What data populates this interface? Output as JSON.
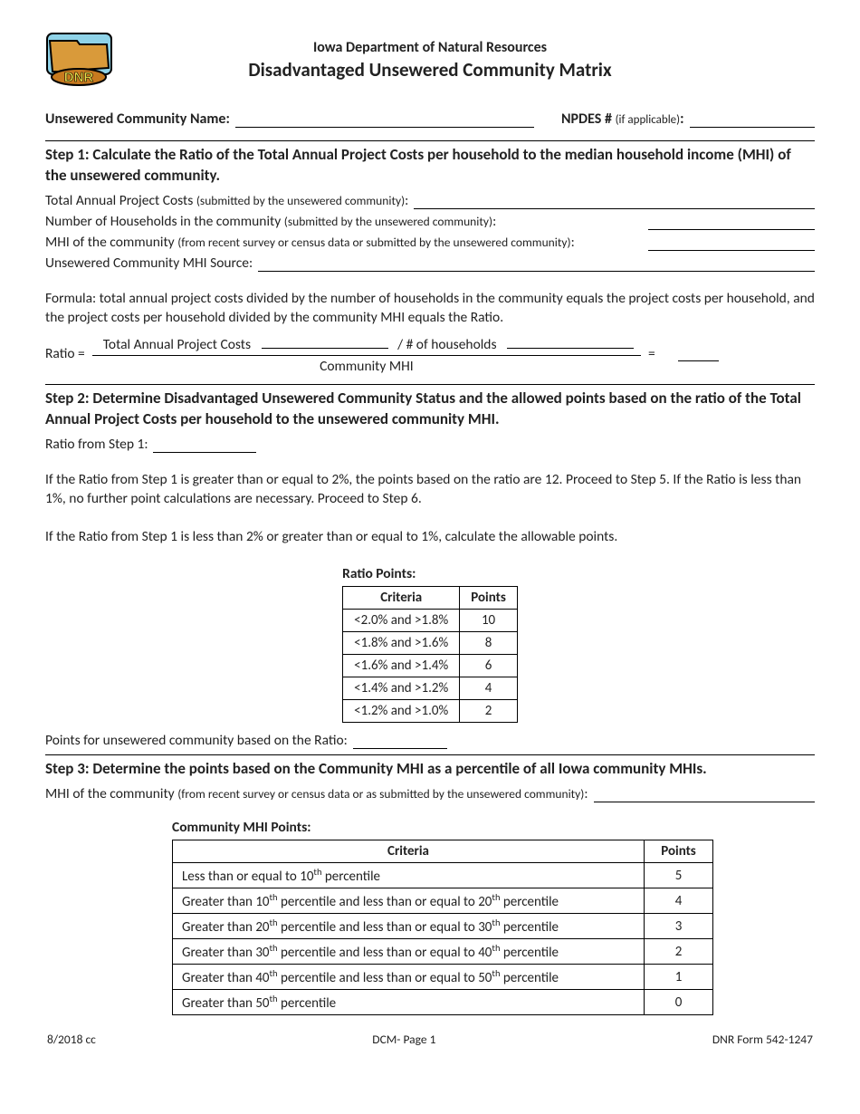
{
  "header": {
    "department": "Iowa Department of Natural Resources",
    "title": "Disadvantaged Unsewered Community Matrix"
  },
  "top": {
    "community_label": "Unsewered Community Name:",
    "npdes_label": "NPDES #",
    "npdes_paren": "(if applicable)",
    "community_value": "",
    "npdes_value": ""
  },
  "step1": {
    "heading": "Step 1: Calculate the Ratio of the Total Annual Project Costs per household to the median household income (MHI) of the unsewered community.",
    "tapc_label": "Total Annual Project Costs",
    "tapc_paren": "(submitted by the unsewered community)",
    "hh_label": "Number of Households in the community",
    "hh_paren": "(submitted by the unsewered community)",
    "mhi_label": "MHI of the community",
    "mhi_paren": "(from recent survey or census data or submitted by the unsewered community)",
    "mhisrc_label": "Unsewered Community MHI Source:",
    "formula_text": "Formula: total annual project costs divided by the number of households in the community equals the project costs per household, and the project costs per household divided by the community MHI equals the Ratio.",
    "ratio_label": "Ratio =",
    "frac_num_left": "Total Annual Project Costs",
    "frac_num_right": "/ # of households",
    "frac_den": "Community MHI",
    "equals": "=",
    "tapc_value": "",
    "hh_value": "",
    "mhi_value": "",
    "mhisrc_value": "",
    "ratio_hh_value": "",
    "ratio_result": ""
  },
  "step2": {
    "heading": "Step 2: Determine Disadvantaged Unsewered Community Status and the allowed points based on the ratio of the Total Annual Project Costs per household to the unsewered community MHI.",
    "ratio_from_label": "Ratio from Step 1:",
    "ratio_from_value": "",
    "para1": "If the Ratio from Step 1 is greater than or equal to 2%, the points based on the ratio are 12. Proceed to Step 5. If the Ratio is less than 1%, no further point calculations are necessary. Proceed to Step 6.",
    "para2": "If the Ratio from Step 1 is less than 2% or greater than or equal to 1%, calculate the allowable points.",
    "table_caption": "Ratio Points:",
    "col_criteria": "Criteria",
    "col_points": "Points",
    "rows": [
      {
        "criteria": "<2.0% and >1.8%",
        "points": "10"
      },
      {
        "criteria": "<1.8% and >1.6%",
        "points": "8"
      },
      {
        "criteria": "<1.6% and >1.4%",
        "points": "6"
      },
      {
        "criteria": "<1.4% and >1.2%",
        "points": "4"
      },
      {
        "criteria": "<1.2% and >1.0%",
        "points": "2"
      }
    ],
    "points_label": "Points for unsewered community based on the Ratio:",
    "points_value": ""
  },
  "step3": {
    "heading": "Step 3: Determine the points based on the Community MHI as a percentile of all Iowa community MHIs.",
    "mhi_label": "MHI of the community",
    "mhi_paren": "(from recent survey or census data or as submitted by the unsewered community)",
    "mhi_value": "",
    "table_caption": "Community MHI Points:",
    "col_criteria": "Criteria",
    "col_points": "Points",
    "rows": [
      {
        "criteria": "Less than or equal to 10<sup>th</sup> percentile",
        "points": "5"
      },
      {
        "criteria": "Greater than 10<sup>th</sup> percentile and less than or equal to 20<sup>th</sup> percentile",
        "points": "4"
      },
      {
        "criteria": "Greater than 20<sup>th</sup> percentile and less than or equal to 30<sup>th</sup> percentile",
        "points": "3"
      },
      {
        "criteria": "Greater than 30<sup>th</sup> percentile and less than or equal to 40<sup>th</sup> percentile",
        "points": "2"
      },
      {
        "criteria": "Greater than 40<sup>th</sup> percentile and less than or equal to 50<sup>th</sup> percentile",
        "points": "1"
      },
      {
        "criteria": "Greater than 50<sup>th</sup> percentile",
        "points": "0"
      }
    ]
  },
  "footer": {
    "left": "8/2018 cc",
    "center": "DCM- Page 1",
    "right": "DNR Form 542-1247"
  },
  "colon": ":"
}
